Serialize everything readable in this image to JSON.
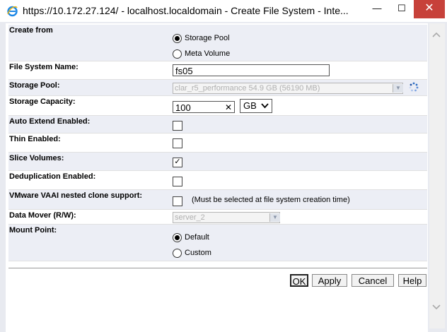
{
  "window": {
    "title": "https://10.172.27.124/ - localhost.localdomain  -  Create File System - Inte...",
    "min_label": "—",
    "max_label": "☐",
    "close_label": "✕"
  },
  "form": {
    "create_from": {
      "label": "Create from",
      "options": [
        "Storage Pool",
        "Meta Volume"
      ],
      "selected": "Storage Pool"
    },
    "fs_name": {
      "label": "File System Name:",
      "value": "fs05"
    },
    "storage_pool": {
      "label": "Storage Pool:",
      "value": "clar_r5_performance 54.9 GB (56190 MB)"
    },
    "storage_capacity": {
      "label": "Storage Capacity:",
      "value": "100",
      "clear_icon": "✕",
      "unit": "GB"
    },
    "auto_extend": {
      "label": "Auto Extend Enabled:",
      "checked": false
    },
    "thin": {
      "label": "Thin Enabled:",
      "checked": false
    },
    "slice_volumes": {
      "label": "Slice Volumes:",
      "checked": true,
      "check_glyph": "✓"
    },
    "dedup": {
      "label": "Deduplication Enabled:",
      "checked": false
    },
    "vaai": {
      "label": "VMware VAAI nested clone support:",
      "checked": false,
      "note": "(Must be selected at file system creation time)"
    },
    "data_mover": {
      "label": "Data Mover (R/W):",
      "value": "server_2"
    },
    "mount_point": {
      "label": "Mount Point:",
      "options": [
        "Default",
        "Custom"
      ],
      "selected": "Default"
    }
  },
  "buttons": {
    "ok": "OK",
    "apply": "Apply",
    "cancel": "Cancel",
    "help": "Help"
  },
  "colors": {
    "row_shade": "#eceef5",
    "close_btn": "#c7413a",
    "ie_blue": "#1e88e5"
  }
}
